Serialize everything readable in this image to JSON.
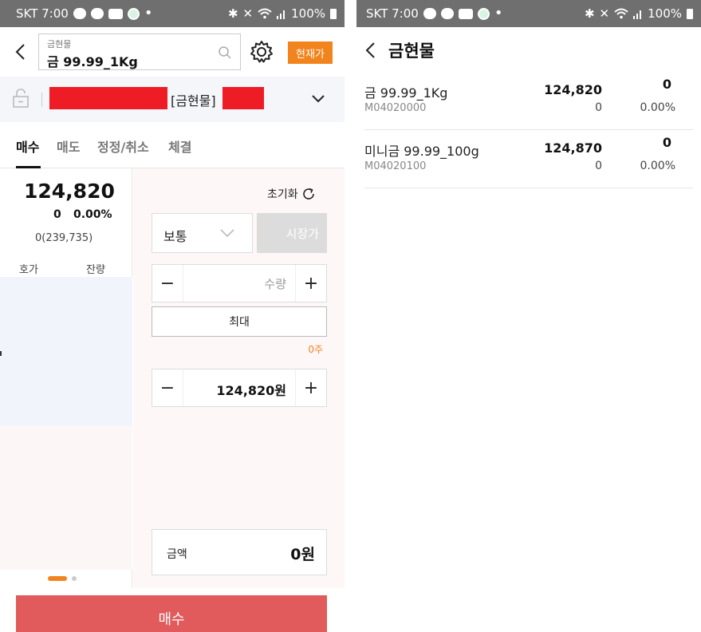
{
  "status_bar": {
    "carrier_time": "SKT 7:00",
    "battery": "100%",
    "icons": [
      "chat-bubble-icon",
      "cloud-app-icon",
      "kbank-app-icon",
      "face-app-icon",
      "bluetooth-icon",
      "mute-icon",
      "wifi-icon",
      "signal-icon",
      "battery-icon"
    ]
  },
  "order_screen": {
    "search": {
      "label": "금현물",
      "value": "금 99.99_1Kg"
    },
    "current_price_button": "현재가",
    "stock_tag": "[금현물]",
    "tabs": [
      "매수",
      "매도",
      "정정/취소",
      "체결"
    ],
    "active_tab": 0,
    "quote": {
      "price": "124,820",
      "change": "0",
      "change_pct": "0.00%",
      "volume": "0(239,735)",
      "orderbook_headers": [
        "호가",
        "잔량"
      ]
    },
    "form": {
      "reset_label": "초기화",
      "order_type": "보통",
      "market_button": "시장가",
      "qty_placeholder": "수량",
      "minus": "−",
      "plus": "+",
      "max_button": "최대",
      "qty_unit": "0주",
      "price_value": "124,820원",
      "amount_label": "금액",
      "amount_value": "0원"
    },
    "buy_button": "매수",
    "colors": {
      "accent": "#f2841e",
      "buy": "#e15a5c",
      "redaction": "#ee1c25"
    }
  },
  "list_screen": {
    "title": "금현물",
    "items": [
      {
        "name": "금 99.99_1Kg",
        "code": "M04020000",
        "price": "124,820",
        "volume": "0",
        "change": "0",
        "change_pct": "0.00%"
      },
      {
        "name": "미니금 99.99_100g",
        "code": "M04020100",
        "price": "124,870",
        "volume": "0",
        "change": "0",
        "change_pct": "0.00%"
      }
    ]
  }
}
